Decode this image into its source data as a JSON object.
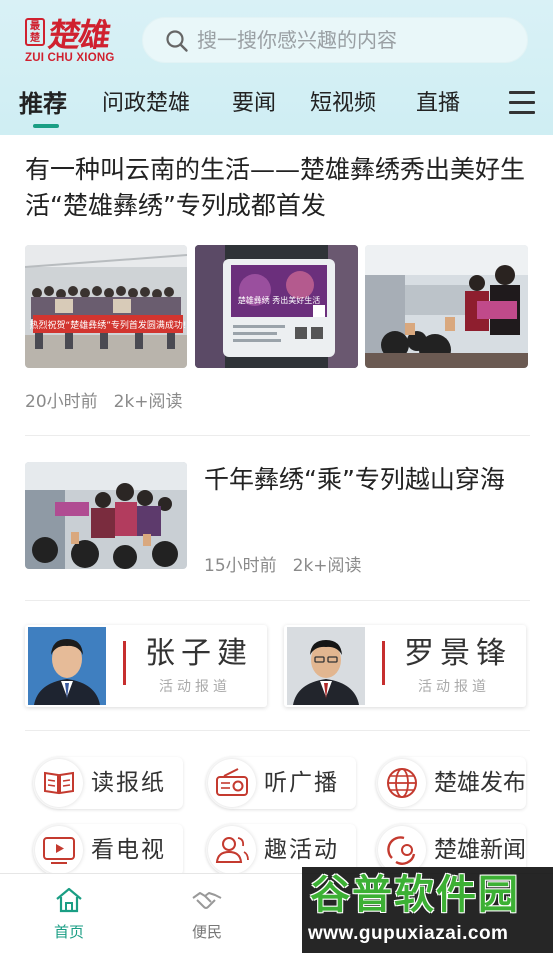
{
  "header": {
    "logo": {
      "seal_text": "最楚",
      "name": "楚雄",
      "subtitle": "ZUI CHU XIONG"
    },
    "search": {
      "placeholder": "搜一搜你感兴趣的内容",
      "icon": "search-icon"
    }
  },
  "tabs": [
    {
      "label": "推荐",
      "active": true
    },
    {
      "label": "问政楚雄",
      "active": false
    },
    {
      "label": "要闻",
      "active": false
    },
    {
      "label": "短视频",
      "active": false
    },
    {
      "label": "直播",
      "active": false
    }
  ],
  "articles": [
    {
      "title": "有一种叫云南的生活——楚雄彝绣秀出美好生活“楚雄彝绣”专列成都首发",
      "time": "20小时前",
      "reads": "2k+阅读",
      "image_texts": [
        "热烈祝贺“楚雄彝绣”专列首发圆满成功!",
        "楚雄彝绣  秀出美好生活"
      ]
    },
    {
      "title": "千年彝绣“乘”专列越山穿海",
      "time": "15小时前",
      "reads": "2k+阅读"
    }
  ],
  "officials": [
    {
      "name": "张子建",
      "subtitle": "活动报道"
    },
    {
      "name": "罗景锋",
      "subtitle": "活动报道"
    }
  ],
  "services": [
    {
      "label": "读报纸",
      "icon": "newspaper-icon"
    },
    {
      "label": "听广播",
      "icon": "radio-icon"
    },
    {
      "label": "楚雄发布",
      "icon": "globe-icon"
    },
    {
      "label": "看电视",
      "icon": "tv-icon"
    },
    {
      "label": "趣活动",
      "icon": "people-icon"
    },
    {
      "label": "楚雄新闻",
      "icon": "news-icon"
    }
  ],
  "bottom_nav": [
    {
      "label": "首页",
      "icon": "home-icon",
      "active": true
    },
    {
      "label": "便民",
      "icon": "handshake-icon",
      "active": false
    }
  ],
  "watermark": {
    "title": "谷普软件园",
    "url": "www.gupuxiazai.com"
  },
  "colors": {
    "accent": "#1a9e84",
    "brand_red": "#d0212f",
    "header_bg": "#d4eff4"
  }
}
